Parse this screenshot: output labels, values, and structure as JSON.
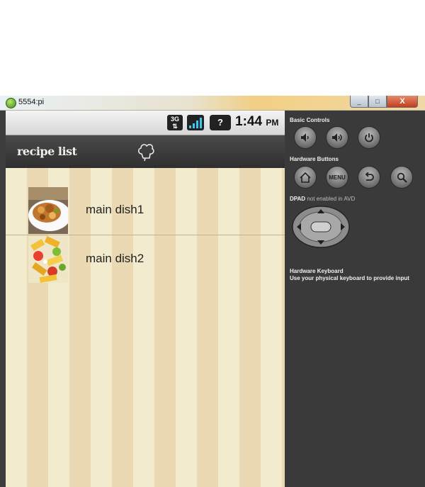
{
  "window": {
    "title": "5554:pi",
    "minimize_glyph": "_",
    "maximize_glyph": "□",
    "close_glyph": "X"
  },
  "status_bar": {
    "network_label": "3G",
    "battery_label": "?",
    "time": "1:44",
    "ampm": "PM"
  },
  "action_bar": {
    "title": "recipe list",
    "icon": "chef-hat-icon"
  },
  "recipes": [
    {
      "name": "main dish1"
    },
    {
      "name": "main dish2"
    }
  ],
  "controls": {
    "basic_controls_label": "Basic Controls",
    "basic_buttons": [
      "volume-down-icon",
      "volume-up-icon",
      "power-icon"
    ],
    "hardware_buttons_label": "Hardware Buttons",
    "menu_label": "MENU",
    "hardware_buttons": [
      "home-icon",
      "menu-button",
      "back-icon",
      "search-icon"
    ],
    "dpad_label": "DPAD",
    "dpad_note": "not enabled in AVD",
    "keyboard_label": "Hardware Keyboard",
    "keyboard_note": "Use your physical keyboard to provide input"
  },
  "colors": {
    "stripe_light": "#f3ebcd",
    "stripe_dark": "#ead9b3",
    "action_bar": "#3a3a3a",
    "controls_panel": "#3a3a3a"
  }
}
